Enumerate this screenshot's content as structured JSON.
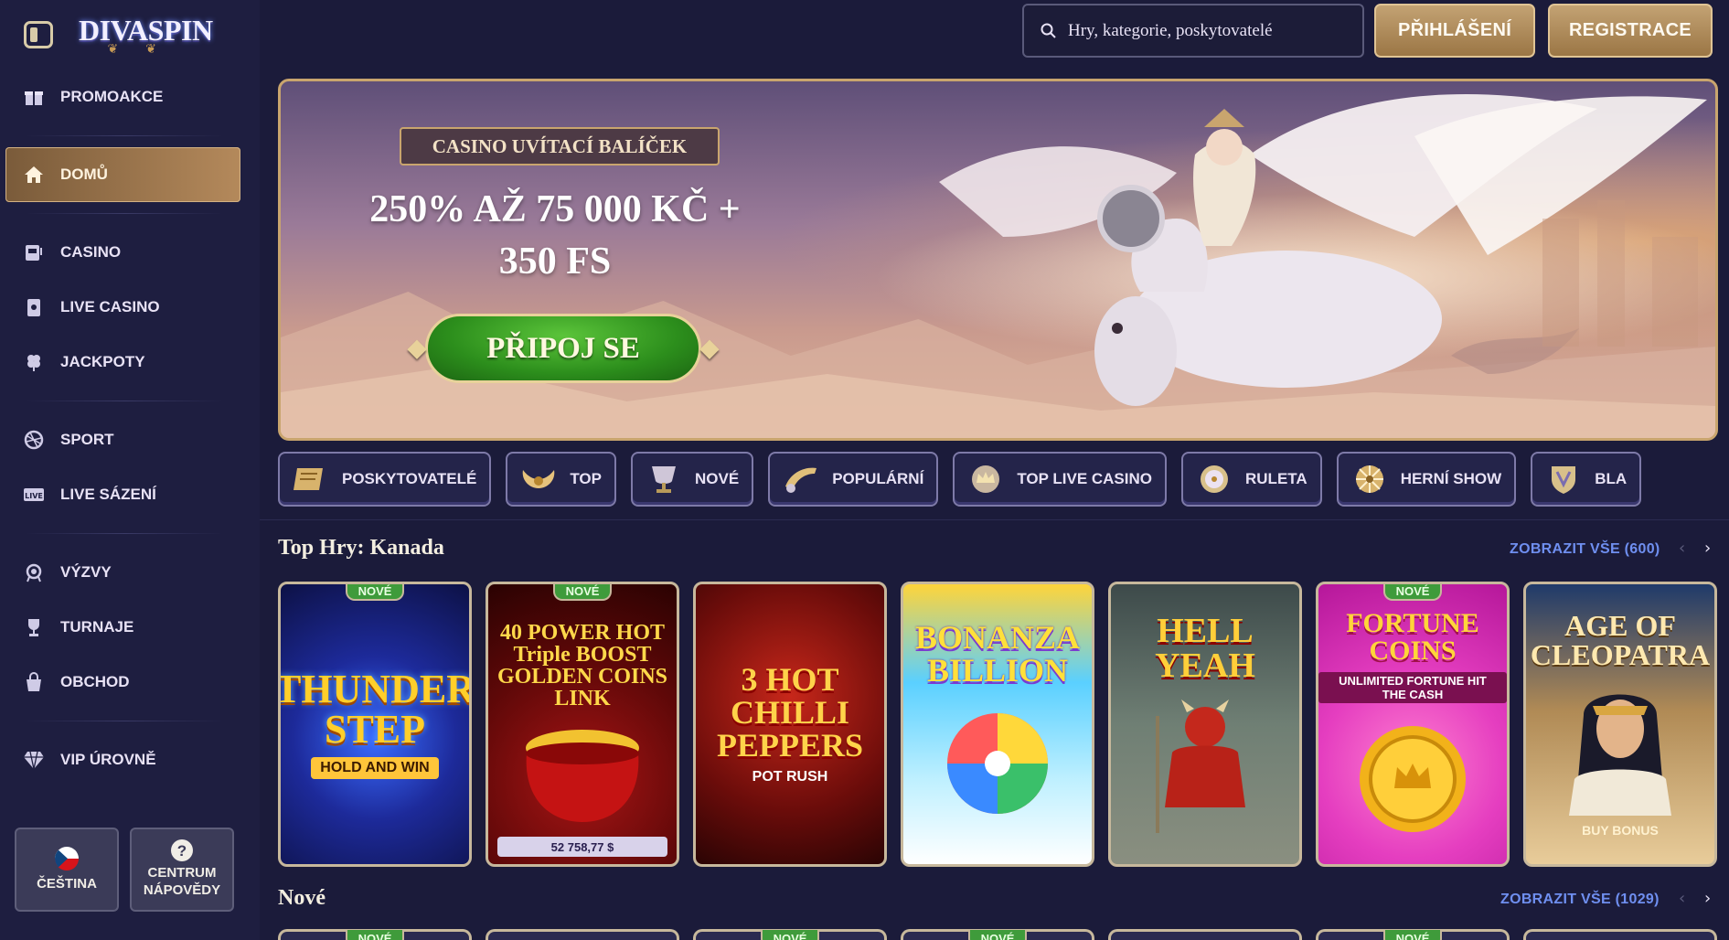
{
  "brand": {
    "logo_text": "DIVASPIN"
  },
  "header": {
    "search_placeholder": "Hry, kategorie, poskytovatelé",
    "login_label": "PŘIHLÁŠENÍ",
    "register_label": "REGISTRACE"
  },
  "sidebar": {
    "items": [
      {
        "label": "PROMOAKCE",
        "icon": "gift-icon"
      },
      {
        "label": "DOMŮ",
        "icon": "home-icon",
        "active": true
      },
      {
        "label": "CASINO",
        "icon": "slot-machine-icon"
      },
      {
        "label": "LIVE CASINO",
        "icon": "card-icon"
      },
      {
        "label": "JACKPOTY",
        "icon": "clover-icon"
      },
      {
        "label": "SPORT",
        "icon": "ball-icon"
      },
      {
        "label": "LIVE SÁZENÍ",
        "icon": "live-icon"
      },
      {
        "label": "VÝZVY",
        "icon": "target-icon"
      },
      {
        "label": "TURNAJE",
        "icon": "trophy-icon"
      },
      {
        "label": "OBCHOD",
        "icon": "bag-icon"
      },
      {
        "label": "VIP ÚROVNĚ",
        "icon": "diamond-icon"
      }
    ],
    "language_label": "ČEŠTINA",
    "help_label_1": "CENTRUM",
    "help_label_2": "NÁPOVĚDY"
  },
  "banner": {
    "tag": "CASINO UVÍTACÍ BALÍČEK",
    "headline_1": "250% AŽ 75 000 KČ +",
    "headline_2": "350 FS",
    "cta": "PŘIPOJ SE"
  },
  "categories": [
    {
      "label": "POSKYTOVATELÉ",
      "icon": "scroll-icon"
    },
    {
      "label": "TOP",
      "icon": "wings-icon"
    },
    {
      "label": "NOVÉ",
      "icon": "cup-icon"
    },
    {
      "label": "POPULÁRNÍ",
      "icon": "horn-icon"
    },
    {
      "label": "TOP LIVE CASINO",
      "icon": "crown-icon"
    },
    {
      "label": "RULETA",
      "icon": "roulette-icon"
    },
    {
      "label": "HERNÍ SHOW",
      "icon": "wheel-icon"
    },
    {
      "label": "BLA",
      "icon": "shield-icon"
    }
  ],
  "sections": {
    "top": {
      "title": "Top Hry: Kanada",
      "see_all": "ZOBRAZIT VŠE (600)"
    },
    "new": {
      "title": "Nové",
      "see_all": "ZOBRAZIT VŠE (1029)"
    }
  },
  "new_badge": "NOVÉ",
  "games": [
    {
      "title": "THUNDER STEP",
      "sub": "HOLD AND WIN",
      "new": true
    },
    {
      "title": "40 POWER HOT Triple BOOST GOLDEN COINS LINK",
      "jackpot": "52 758,77 $",
      "new": true
    },
    {
      "title": "3 HOT CHILLI PEPPERS",
      "sub": "POT RUSH",
      "new": false
    },
    {
      "title": "BONANZA BILLION",
      "new": false
    },
    {
      "title": "HELL YEAH",
      "new": false
    },
    {
      "title": "FORTUNE COINS",
      "sub": "UNLIMITED FORTUNE HIT THE CASH",
      "new": true
    },
    {
      "title": "AGE OF CLEOPATRA",
      "sub": "BUY BONUS",
      "new": false
    }
  ],
  "colors": {
    "background": "#1b1b3a",
    "sidebar": "#1e1e40",
    "gold": "#c9a56e",
    "link": "#6f8ff0",
    "new_badge": "#3f9b3b",
    "cta_green": "#2c8e1c"
  }
}
